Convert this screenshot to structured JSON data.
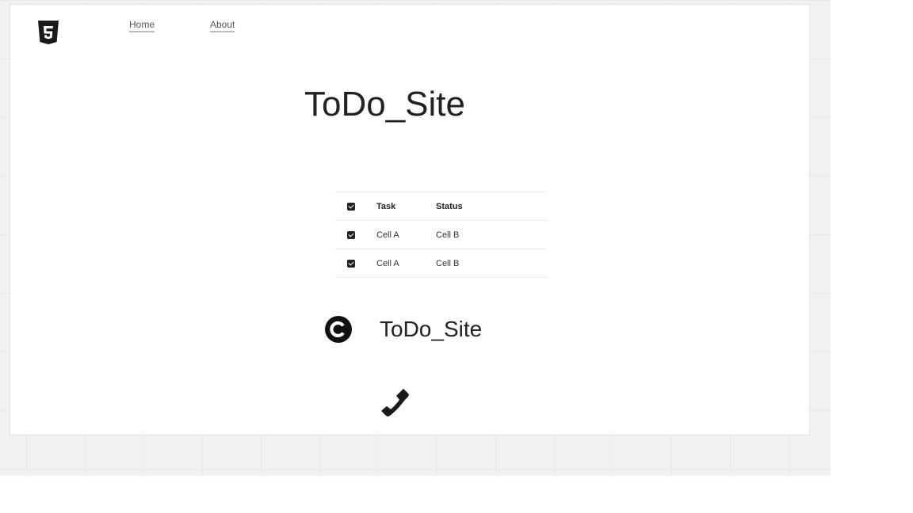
{
  "nav": {
    "logo_icon": "html5-icon",
    "home": "Home",
    "about": "About"
  },
  "main": {
    "title": "ToDo_Site"
  },
  "table": {
    "headers": [
      "Task",
      "Status"
    ],
    "rows": [
      {
        "task": "Cell A",
        "status": "Cell B",
        "checked": true
      },
      {
        "task": "Cell A",
        "status": "Cell B",
        "checked": true
      }
    ]
  },
  "footer": {
    "copyright_icon": "copyright-icon",
    "brand": "ToDo_Site",
    "phone_icon": "phone-icon"
  },
  "colors": {
    "background": "#f1f1f1",
    "page": "#ffffff",
    "text": "#222222"
  }
}
